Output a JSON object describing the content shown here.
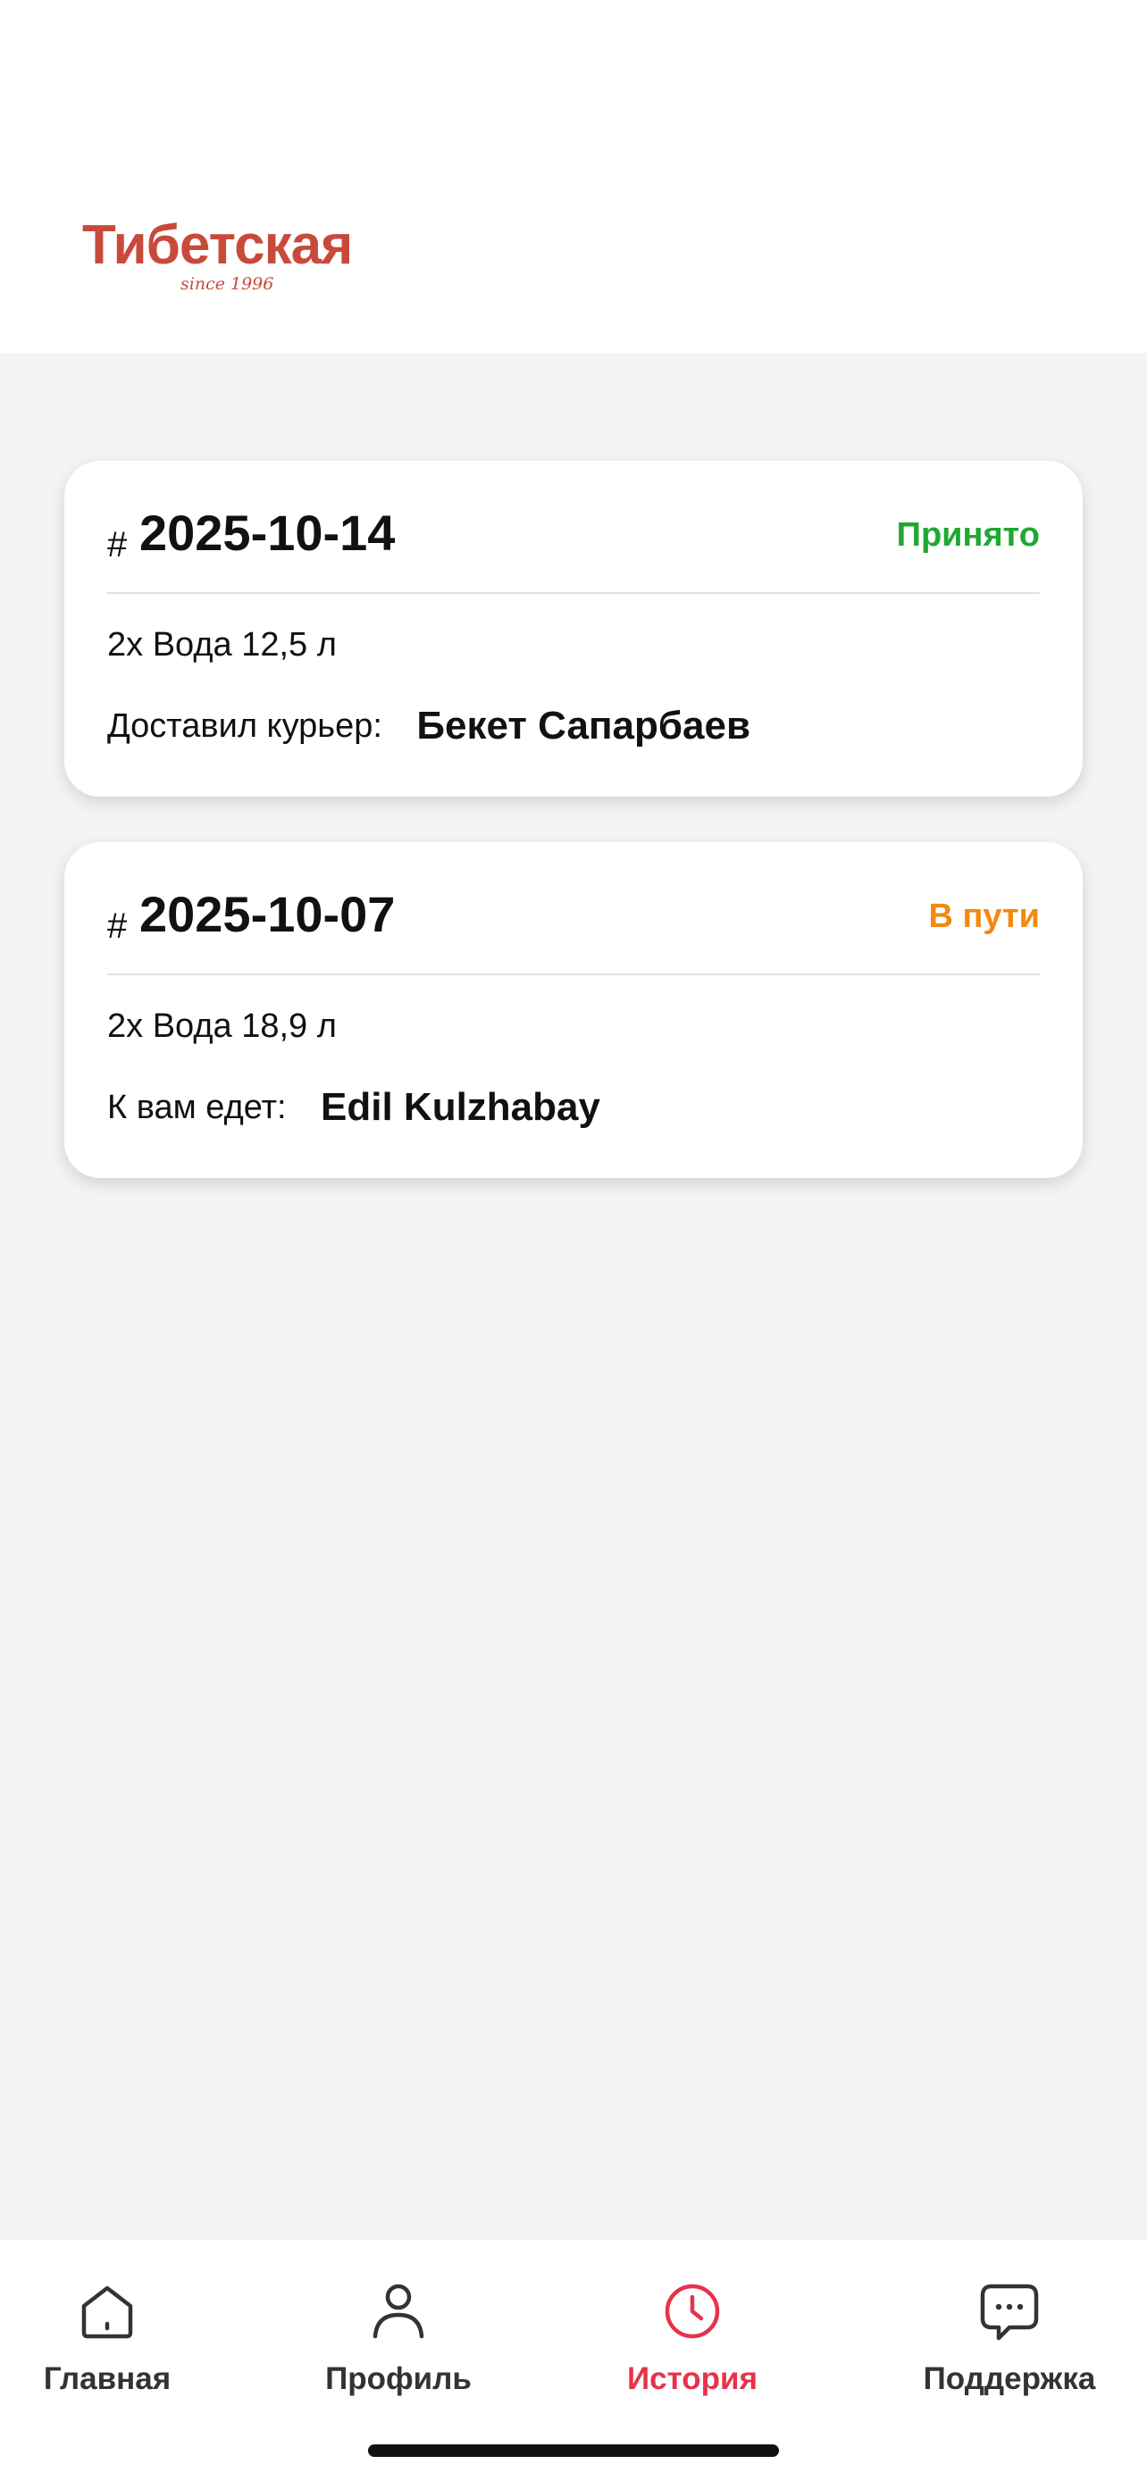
{
  "header": {
    "logo_title": "Тибетская",
    "logo_subtitle": "since 1996",
    "brand_color": "#c84a3a"
  },
  "orders": [
    {
      "hash": "#",
      "date": "2025-10-14",
      "status": "Принято",
      "status_color": "#1fa832",
      "items": "2х Вода 12,5 л",
      "courier_label": "Доставил курьер:",
      "courier_name": "Бекет Сапарбаев"
    },
    {
      "hash": "#",
      "date": "2025-10-07",
      "status": "В пути",
      "status_color": "#f08a10",
      "items": "2х Вода 18,9 л",
      "courier_label": "К вам едет:",
      "courier_name": "Edil Kulzhabay"
    }
  ],
  "tabbar": {
    "tabs": [
      {
        "label": "Главная",
        "icon": "home-icon",
        "active": false
      },
      {
        "label": "Профиль",
        "icon": "profile-icon",
        "active": false
      },
      {
        "label": "История",
        "icon": "clock-icon",
        "active": true
      },
      {
        "label": "Поддержка",
        "icon": "chat-icon",
        "active": false
      }
    ],
    "active_color": "#e8324a",
    "inactive_color": "#333333"
  }
}
